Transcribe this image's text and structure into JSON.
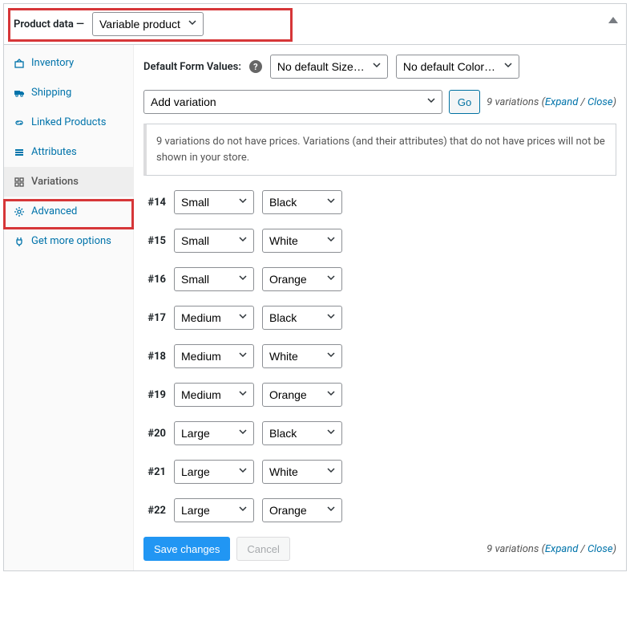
{
  "header": {
    "label": "Product data —",
    "productType": "Variable product"
  },
  "sidebar": {
    "items": [
      {
        "label": "Inventory"
      },
      {
        "label": "Shipping"
      },
      {
        "label": "Linked Products"
      },
      {
        "label": "Attributes"
      },
      {
        "label": "Variations"
      },
      {
        "label": "Advanced"
      },
      {
        "label": "Get more options"
      }
    ]
  },
  "main": {
    "defaultFormLabel": "Default Form Values:",
    "defaultSize": "No default Size…",
    "defaultColor": "No default Color…",
    "addVariation": "Add variation",
    "goLabel": "Go",
    "countsText": "9 variations",
    "expandLabel": "Expand",
    "closeLabel": "Close",
    "noticeText": "9 variations do not have prices. Variations (and their attributes) that do not have prices will not be shown in your store.",
    "variations": [
      {
        "id": "#14",
        "size": "Small",
        "color": "Black"
      },
      {
        "id": "#15",
        "size": "Small",
        "color": "White"
      },
      {
        "id": "#16",
        "size": "Small",
        "color": "Orange"
      },
      {
        "id": "#17",
        "size": "Medium",
        "color": "Black"
      },
      {
        "id": "#18",
        "size": "Medium",
        "color": "White"
      },
      {
        "id": "#19",
        "size": "Medium",
        "color": "Orange"
      },
      {
        "id": "#20",
        "size": "Large",
        "color": "Black"
      },
      {
        "id": "#21",
        "size": "Large",
        "color": "White"
      },
      {
        "id": "#22",
        "size": "Large",
        "color": "Orange"
      }
    ],
    "saveLabel": "Save changes",
    "cancelLabel": "Cancel"
  }
}
